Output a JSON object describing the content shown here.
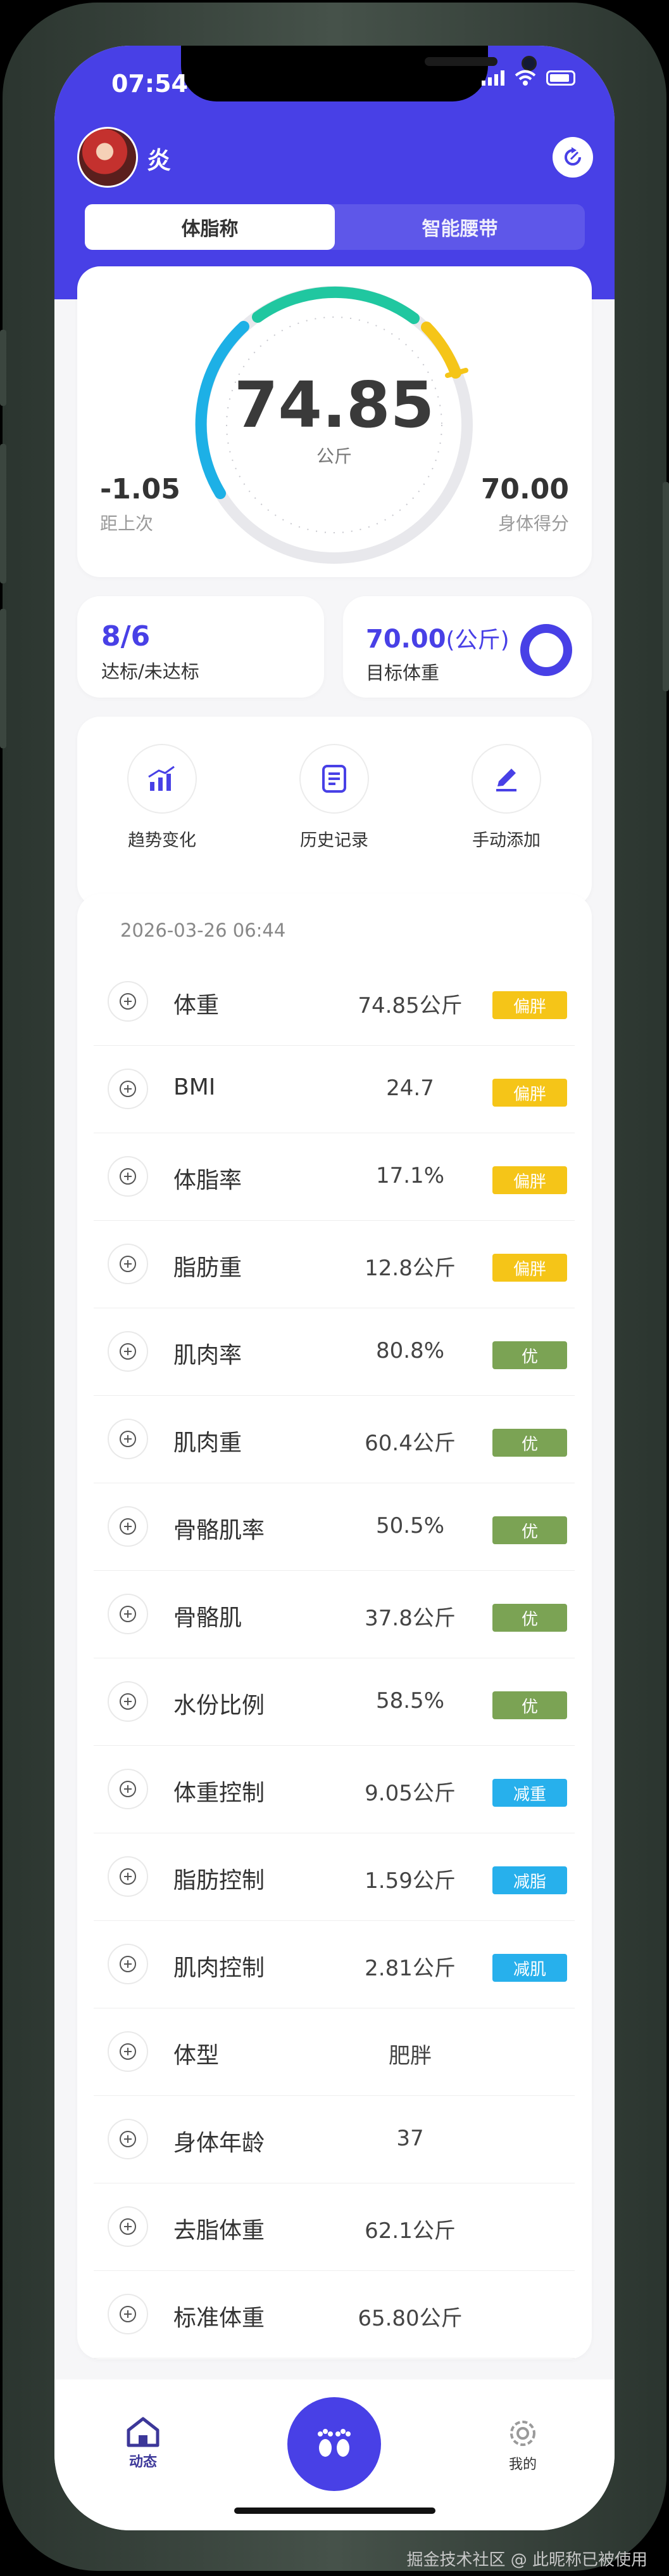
{
  "status_bar": {
    "time": "07:54"
  },
  "profile": {
    "name": "炎"
  },
  "tabs": [
    "体脂称",
    "智能腰带"
  ],
  "score_card": {
    "weight_value": "74.85",
    "weight_unit": "公斤",
    "diff_value": "-1.05",
    "diff_label": "距上次",
    "score_value": "70.00",
    "score_label": "身体得分"
  },
  "target_summary": {
    "count": "8/6",
    "count_label": "达标/未达标",
    "target_value": "70.00",
    "target_unit": "(公斤)",
    "target_label": "目标体重"
  },
  "quick_actions": [
    "趋势变化",
    "历史记录",
    "手动添加"
  ],
  "record": {
    "date": "2026-03-26 06:44",
    "rows": [
      {
        "name": "体重",
        "value": "74.85公斤",
        "tag": "偏胖",
        "tag_color": "#f5c518",
        "icon": "scale-icon"
      },
      {
        "name": "BMI",
        "value": "24.7",
        "tag": "偏胖",
        "tag_color": "#f5c518",
        "icon": "bmi-icon"
      },
      {
        "name": "体脂率",
        "value": "17.1%",
        "tag": "偏胖",
        "tag_color": "#f5c518",
        "icon": "fat-rate-icon"
      },
      {
        "name": "脂肪重",
        "value": "12.8公斤",
        "tag": "偏胖",
        "tag_color": "#f5c518",
        "icon": "fat-weight-icon"
      },
      {
        "name": "肌肉率",
        "value": "80.8%",
        "tag": "优",
        "tag_color": "#7ba354",
        "icon": "muscle-rate-icon"
      },
      {
        "name": "肌肉重",
        "value": "60.4公斤",
        "tag": "优",
        "tag_color": "#7ba354",
        "icon": "muscle-weight-icon"
      },
      {
        "name": "骨骼肌率",
        "value": "50.5%",
        "tag": "优",
        "tag_color": "#7ba354",
        "icon": "skeletal-muscle-rate-icon"
      },
      {
        "name": "骨骼肌",
        "value": "37.8公斤",
        "tag": "优",
        "tag_color": "#7ba354",
        "icon": "skeletal-muscle-icon"
      },
      {
        "name": "水份比例",
        "value": "58.5%",
        "tag": "优",
        "tag_color": "#7ba354",
        "icon": "water-icon"
      },
      {
        "name": "体重控制",
        "value": "9.05公斤",
        "tag": "减重",
        "tag_color": "#27b0ec",
        "icon": "weight-control-icon"
      },
      {
        "name": "脂肪控制",
        "value": "1.59公斤",
        "tag": "减脂",
        "tag_color": "#27b0ec",
        "icon": "fat-control-icon"
      },
      {
        "name": "肌肉控制",
        "value": "2.81公斤",
        "tag": "减肌",
        "tag_color": "#27b0ec",
        "icon": "muscle-control-icon"
      },
      {
        "name": "体型",
        "value": "肥胖",
        "tag": "",
        "tag_color": "",
        "icon": "body-shape-icon"
      },
      {
        "name": "身体年龄",
        "value": "37",
        "tag": "",
        "tag_color": "",
        "icon": "body-age-icon"
      },
      {
        "name": "去脂体重",
        "value": "62.1公斤",
        "tag": "",
        "tag_color": "",
        "icon": "lean-mass-icon"
      },
      {
        "name": "标准体重",
        "value": "65.80公斤",
        "tag": "",
        "tag_color": "",
        "icon": "standard-weight-icon"
      }
    ]
  },
  "tab_bar": {
    "left": "动态",
    "right": "我的"
  },
  "watermark": "掘金技术社区 @ 此昵称已被使用",
  "colors": {
    "accent": "#4840e6",
    "warn": "#f5c518",
    "good": "#7ba354",
    "info": "#27b0ec"
  }
}
